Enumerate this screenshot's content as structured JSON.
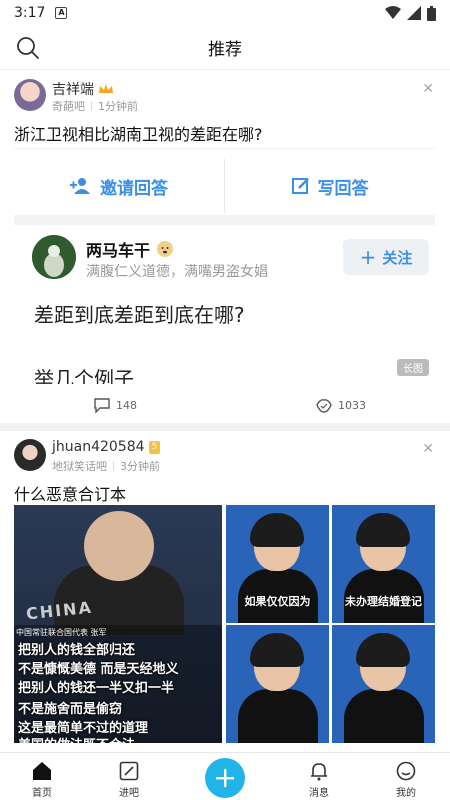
{
  "status": {
    "time": "3:17",
    "notif_glyph": "A"
  },
  "header": {
    "title": "推荐"
  },
  "post1": {
    "username": "吉祥端",
    "forum": "奇葩吧",
    "time": "1分钟前",
    "title": "浙江卫视相比湖南卫视的差距在哪?",
    "screenshot": {
      "invite_label": "邀请回答",
      "write_label": "写回答",
      "author": "两马车干",
      "author_sub": "满腹仁义道德，满嘴男盗女娼",
      "follow_label": "关注",
      "question": "差距到底差距到底在哪?",
      "example": "举几个例子",
      "badge": "长图"
    },
    "comments": "148",
    "likes": "1033"
  },
  "post2": {
    "username": "jhuan420584",
    "level": "5",
    "forum": "地狱笑话吧",
    "time": "3分钟前",
    "title": "什么恶意合订本",
    "big_image": {
      "banner": "CHINA",
      "small_caption": "中国常驻联合国代表 张军",
      "captions": [
        "把别人的钱全部归还",
        "不是慷慨美德 而是天经地义",
        "把别人的钱还一半又扣一半",
        "不是施舍而是偷窃",
        "这是最简单不过的道理",
        "美国的做法既不合法"
      ]
    },
    "thumbs": [
      {
        "caption": "如果仅仅因为"
      },
      {
        "caption": "未办理结婚登记"
      },
      {
        "caption": ""
      },
      {
        "caption": ""
      }
    ]
  },
  "nav": {
    "items": [
      {
        "label": "首页"
      },
      {
        "label": "进吧"
      },
      {
        "label": "消息"
      },
      {
        "label": "我的"
      }
    ]
  },
  "colors": {
    "accent": "#21b4e8",
    "link_blue": "#3a8fe8"
  }
}
